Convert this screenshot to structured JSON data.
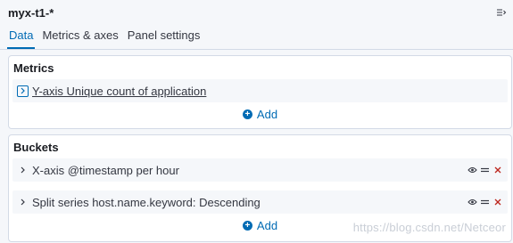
{
  "header": {
    "title": "myx-t1-*"
  },
  "tabs": [
    {
      "label": "Data",
      "active": true
    },
    {
      "label": "Metrics & axes",
      "active": false
    },
    {
      "label": "Panel settings",
      "active": false
    }
  ],
  "metrics": {
    "title": "Metrics",
    "items": [
      {
        "label": "Y-axis Unique count of application"
      }
    ],
    "add_label": "Add"
  },
  "buckets": {
    "title": "Buckets",
    "items": [
      {
        "label": "X-axis @timestamp per hour"
      },
      {
        "label": "Split series host.name.keyword: Descending"
      }
    ],
    "add_label": "Add"
  },
  "watermark": "https://blog.csdn.net/Netceor",
  "colors": {
    "accent": "#006bb4",
    "danger": "#bd271e",
    "background": "#f5f7fa",
    "border": "#d3dae6"
  }
}
